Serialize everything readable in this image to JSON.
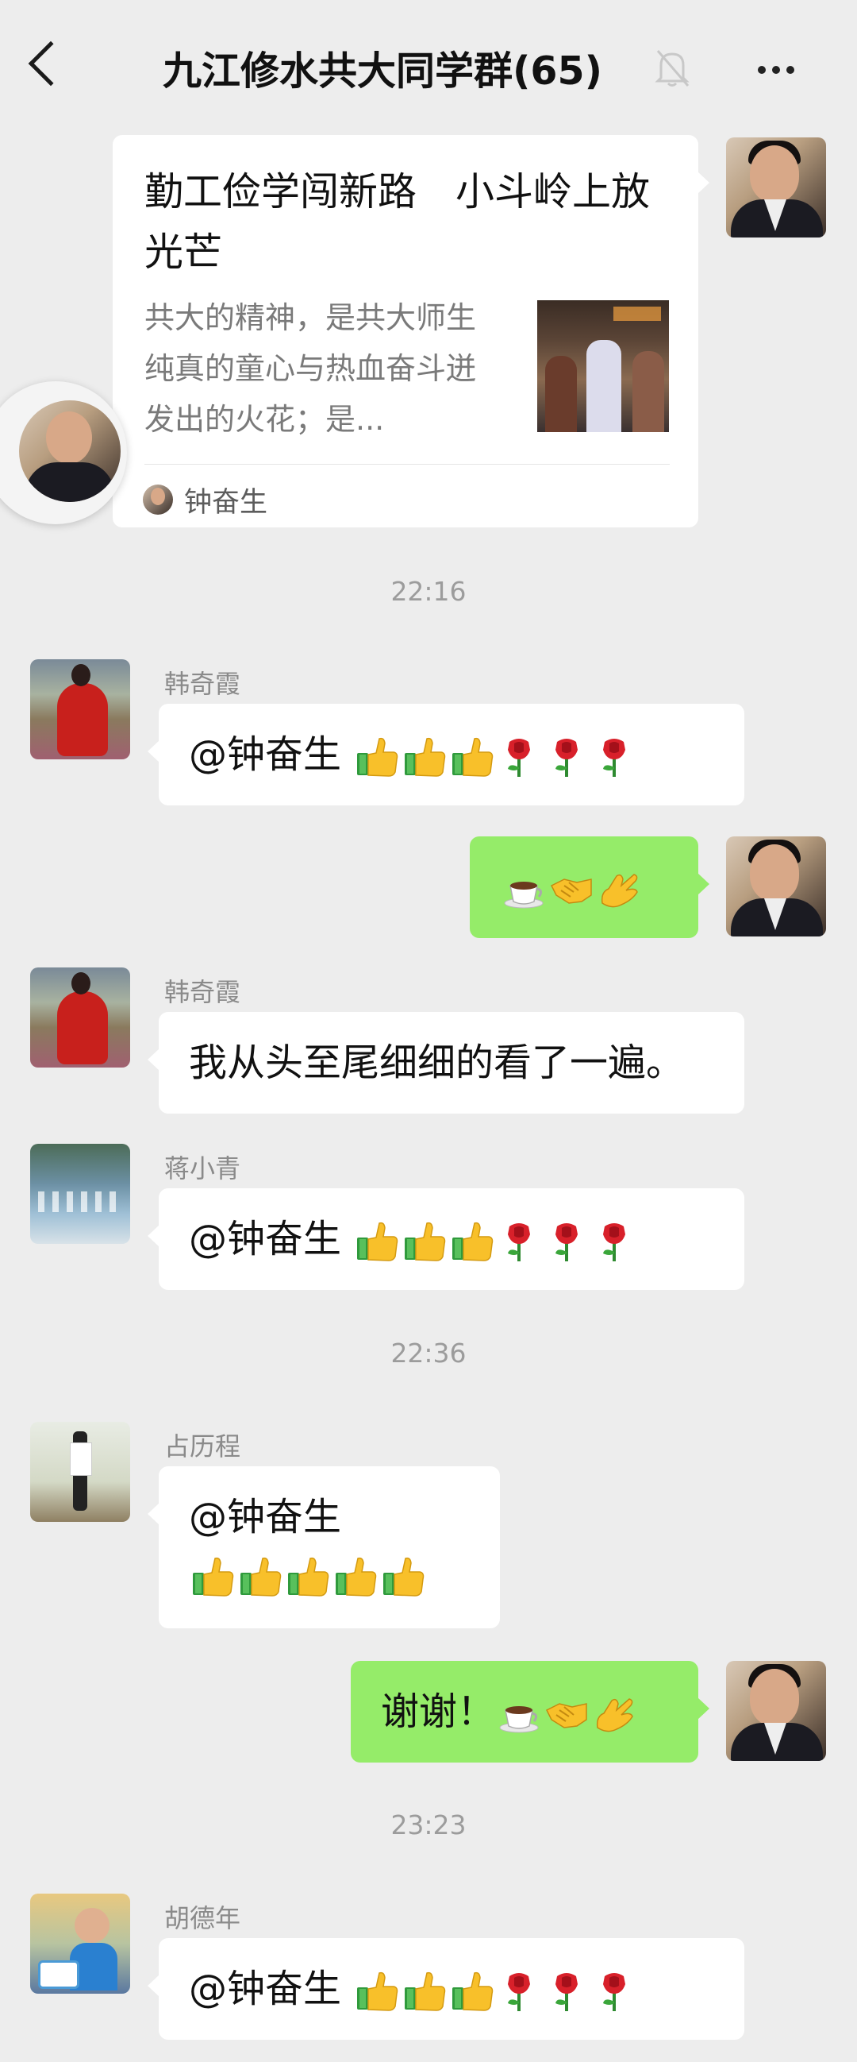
{
  "header": {
    "title": "九江修水共大同学群(65)",
    "icons": [
      "back-arrow-icon",
      "mute-bell-icon",
      "more-dots-icon"
    ]
  },
  "shared_card": {
    "title": "勤工俭学闯新路　小斗岭上放光芒",
    "description": "共大的精神，是共大师生纯真的童心与热血奋斗迸发出的火花；是...",
    "source": "钟奋生"
  },
  "messages": [
    {
      "type": "time",
      "text": "22:16"
    },
    {
      "sender": "韩奇霞",
      "text": "@钟奋生 ",
      "emoji": [
        "thumbs-up",
        "thumbs-up",
        "thumbs-up",
        "rose",
        "rose",
        "rose"
      ]
    },
    {
      "sender": "self",
      "text": "",
      "emoji": [
        "coffee",
        "handshake",
        "ok-hand"
      ]
    },
    {
      "sender": "韩奇霞",
      "text": "我从头至尾细细的看了一遍。"
    },
    {
      "sender": "蒋小青",
      "text": "@钟奋生 ",
      "emoji": [
        "thumbs-up",
        "thumbs-up",
        "thumbs-up",
        "rose",
        "rose",
        "rose"
      ]
    },
    {
      "type": "time",
      "text": "22:36"
    },
    {
      "sender": "占历程",
      "text": "@钟奋生",
      "emoji": [
        "thumbs-up",
        "thumbs-up",
        "thumbs-up",
        "thumbs-up",
        "thumbs-up"
      ]
    },
    {
      "sender": "self",
      "text": "谢谢！",
      "emoji": [
        "coffee",
        "handshake",
        "ok-hand"
      ]
    },
    {
      "type": "time",
      "text": "23:23"
    },
    {
      "sender": "胡德年",
      "text": "@钟奋生 ",
      "emoji": [
        "thumbs-up",
        "thumbs-up",
        "thumbs-up",
        "rose",
        "rose",
        "rose"
      ]
    }
  ],
  "colors": {
    "background": "#ededed",
    "self_bubble": "#95ec69",
    "other_bubble": "#ffffff",
    "meta_text": "#8a8a8a"
  }
}
